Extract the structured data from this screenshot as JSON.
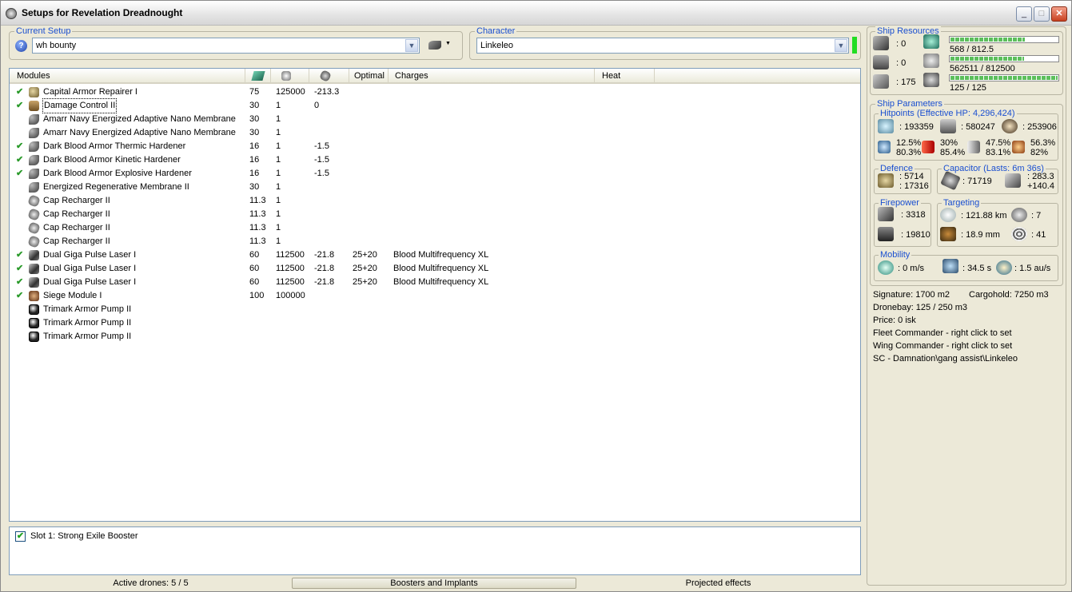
{
  "window": {
    "title": "Setups for Revelation Dreadnought"
  },
  "current_setup": {
    "label": "Current Setup",
    "value": "wh bounty",
    "help": "?"
  },
  "character": {
    "label": "Character",
    "value": "Linkeleo",
    "status_color": "#22dd22"
  },
  "modules": {
    "columns": [
      "Modules",
      "",
      "",
      "",
      "Optimal",
      "Charges",
      "Heat"
    ],
    "rows": [
      {
        "checked": true,
        "icon": "armor-repairer-icon",
        "name": "Capital Armor Repairer I",
        "cpu": "75",
        "pg": "125000",
        "cap": "-213.3",
        "optimal": "",
        "charges": ""
      },
      {
        "checked": true,
        "icon": "damage-control-icon",
        "name": "Damage Control II",
        "cpu": "30",
        "pg": "1",
        "cap": "0",
        "optimal": "",
        "charges": ""
      },
      {
        "checked": false,
        "icon": "armor-membrane-icon",
        "name": "Amarr Navy Energized Adaptive Nano Membrane",
        "cpu": "30",
        "pg": "1",
        "cap": "",
        "optimal": "",
        "charges": ""
      },
      {
        "checked": false,
        "icon": "armor-membrane-icon",
        "name": "Amarr Navy Energized Adaptive Nano Membrane",
        "cpu": "30",
        "pg": "1",
        "cap": "",
        "optimal": "",
        "charges": ""
      },
      {
        "checked": true,
        "icon": "armor-hardener-icon",
        "name": "Dark Blood Armor Thermic Hardener",
        "cpu": "16",
        "pg": "1",
        "cap": "-1.5",
        "optimal": "",
        "charges": ""
      },
      {
        "checked": true,
        "icon": "armor-hardener-icon",
        "name": "Dark Blood Armor Kinetic Hardener",
        "cpu": "16",
        "pg": "1",
        "cap": "-1.5",
        "optimal": "",
        "charges": ""
      },
      {
        "checked": true,
        "icon": "armor-hardener-icon",
        "name": "Dark Blood Armor Explosive Hardener",
        "cpu": "16",
        "pg": "1",
        "cap": "-1.5",
        "optimal": "",
        "charges": ""
      },
      {
        "checked": false,
        "icon": "armor-membrane-icon",
        "name": "Energized Regenerative Membrane II",
        "cpu": "30",
        "pg": "1",
        "cap": "",
        "optimal": "",
        "charges": ""
      },
      {
        "checked": false,
        "icon": "cap-recharger-icon",
        "name": "Cap Recharger II",
        "cpu": "11.3",
        "pg": "1",
        "cap": "",
        "optimal": "",
        "charges": ""
      },
      {
        "checked": false,
        "icon": "cap-recharger-icon",
        "name": "Cap Recharger II",
        "cpu": "11.3",
        "pg": "1",
        "cap": "",
        "optimal": "",
        "charges": ""
      },
      {
        "checked": false,
        "icon": "cap-recharger-icon",
        "name": "Cap Recharger II",
        "cpu": "11.3",
        "pg": "1",
        "cap": "",
        "optimal": "",
        "charges": ""
      },
      {
        "checked": false,
        "icon": "cap-recharger-icon",
        "name": "Cap Recharger II",
        "cpu": "11.3",
        "pg": "1",
        "cap": "",
        "optimal": "",
        "charges": ""
      },
      {
        "checked": true,
        "icon": "pulse-laser-icon",
        "name": "Dual Giga Pulse Laser I",
        "cpu": "60",
        "pg": "112500",
        "cap": "-21.8",
        "optimal": "25+20",
        "charges": "Blood Multifrequency XL"
      },
      {
        "checked": true,
        "icon": "pulse-laser-icon",
        "name": "Dual Giga Pulse Laser I",
        "cpu": "60",
        "pg": "112500",
        "cap": "-21.8",
        "optimal": "25+20",
        "charges": "Blood Multifrequency XL"
      },
      {
        "checked": true,
        "icon": "pulse-laser-icon",
        "name": "Dual Giga Pulse Laser I",
        "cpu": "60",
        "pg": "112500",
        "cap": "-21.8",
        "optimal": "25+20",
        "charges": "Blood Multifrequency XL"
      },
      {
        "checked": true,
        "icon": "siege-module-icon",
        "name": "Siege Module I",
        "cpu": "100",
        "pg": "100000",
        "cap": "",
        "optimal": "",
        "charges": ""
      },
      {
        "checked": false,
        "icon": "rig-icon",
        "name": "Trimark Armor Pump II",
        "cpu": "",
        "pg": "",
        "cap": "",
        "optimal": "",
        "charges": ""
      },
      {
        "checked": false,
        "icon": "rig-icon",
        "name": "Trimark Armor Pump II",
        "cpu": "",
        "pg": "",
        "cap": "",
        "optimal": "",
        "charges": ""
      },
      {
        "checked": false,
        "icon": "rig-icon",
        "name": "Trimark Armor Pump II",
        "cpu": "",
        "pg": "",
        "cap": "",
        "optimal": "",
        "charges": ""
      }
    ]
  },
  "booster": {
    "label": "Slot 1: Strong Exile Booster",
    "checked": true
  },
  "status": {
    "drones": "Active drones: 5 / 5",
    "boosters_tab": "Boosters and Implants",
    "projected": "Projected effects"
  },
  "ship_resources": {
    "label": "Ship Resources",
    "turret_hardpoints": ": 0",
    "launcher_hardpoints": ": 0",
    "calibration": ": 175",
    "cpu": {
      "text": "568 / 812.5",
      "fraction": 0.699
    },
    "powergrid": {
      "text": "562511 / 812500",
      "fraction": 0.692
    },
    "drone_bandwidth": {
      "text": "125 / 125",
      "fraction": 1.0
    }
  },
  "ship_parameters": {
    "label": "Ship Parameters",
    "hitpoints": {
      "label": "Hitpoints (Effective HP: 4,296,424)",
      "shield": ": 193359",
      "armor": ": 580247",
      "structure": ": 253906",
      "em": [
        "12.5%",
        "80.3%"
      ],
      "thermal": [
        "30%",
        "85.4%"
      ],
      "kinetic": [
        "47.5%",
        "83.1%"
      ],
      "explosive": [
        "56.3%",
        "82%"
      ]
    },
    "defence": {
      "label": "Defence",
      "values": [
        ": 5714",
        ": 17316"
      ]
    },
    "capacitor": {
      "label": "Capacitor (Lasts: 6m 36s)",
      "capacity": ": 71719",
      "values": [
        ": 283.3",
        "+140.4"
      ]
    },
    "firepower": {
      "label": "Firepower",
      "dps": ": 3318",
      "volley": ": 19810"
    },
    "targeting": {
      "label": "Targeting",
      "range": ": 121.88 km",
      "max_targets": ": 7",
      "sensor": ": 18.9 mm",
      "scan_res": ": 41"
    },
    "mobility": {
      "label": "Mobility",
      "speed": ": 0 m/s",
      "align": ": 34.5 s",
      "warp": ": 1.5 au/s"
    }
  },
  "info": {
    "signature": "Signature: 1700 m2",
    "cargohold": "Cargohold: 7250 m3",
    "dronebay": "Dronebay: 125 / 250 m3",
    "price": "Price: 0 isk",
    "fleet": "Fleet Commander - right click to set",
    "wing": "Wing Commander - right click to set",
    "squad": "SC - Damnation\\gang assist\\Linkeleo"
  }
}
